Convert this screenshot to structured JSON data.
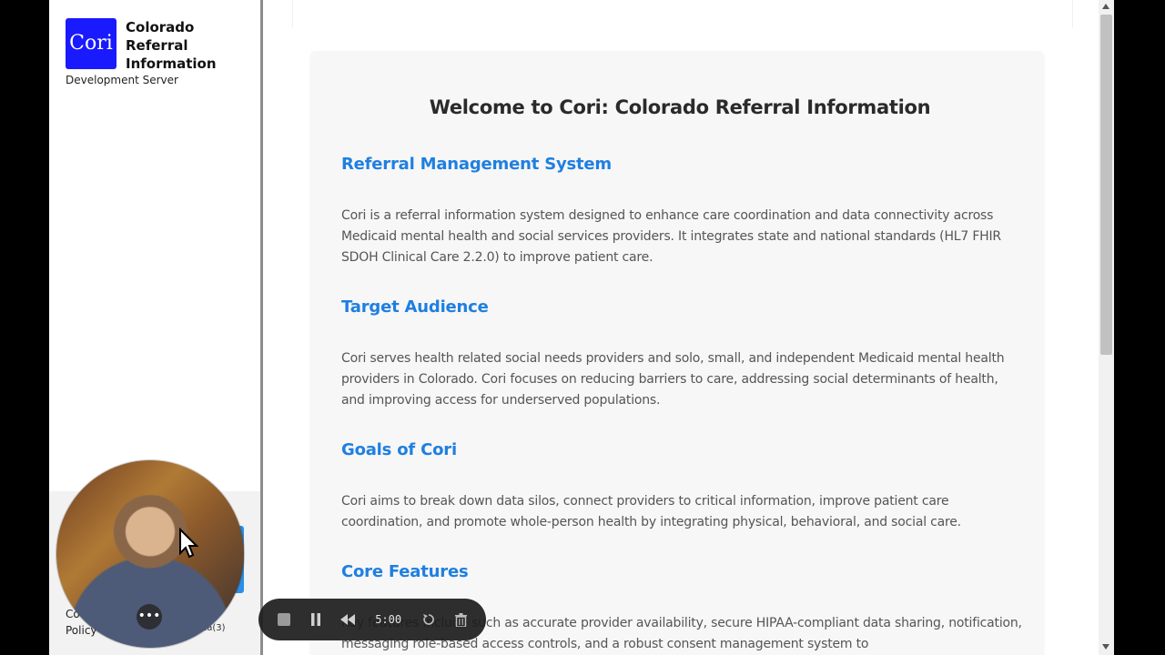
{
  "sidebar": {
    "logo_text": "Cori",
    "brand_name": "Colorado Referral Information",
    "server_label": "Development Server",
    "footer_line1": "Co",
    "footer_line2": "Policy",
    "footer_small": "ica(3)"
  },
  "main": {
    "welcome_title": "Welcome to Cori: Colorado Referral Information",
    "sections": [
      {
        "heading": "Referral Management System",
        "body": "Cori is a referral information system designed to enhance care coordination and data connectivity across Medicaid mental health and social services providers. It integrates state and national standards (HL7 FHIR SDOH Clinical Care 2.2.0) to improve patient care."
      },
      {
        "heading": "Target Audience",
        "body": "Cori serves health related social needs providers and solo, small, and independent Medicaid mental health providers in Colorado. Cori focuses on reducing barriers to care, addressing social determinants of health, and improving access for underserved populations."
      },
      {
        "heading": "Goals of Cori",
        "body": "Cori aims to break down data silos, connect providers to critical information, improve patient care coordination, and promote whole-person health by integrating physical, behavioral, and social care."
      },
      {
        "heading": "Core Features",
        "body": "Key features include such as accurate provider availability, secure HIPAA-compliant data sharing, notification, messaging role-based access controls, and a robust consent management system to"
      }
    ]
  },
  "recorder": {
    "time": "5:00"
  },
  "colors": {
    "logo_blue": "#1a1aff",
    "heading_blue": "#1f7fe0",
    "card_bg": "#f7f7f7"
  }
}
